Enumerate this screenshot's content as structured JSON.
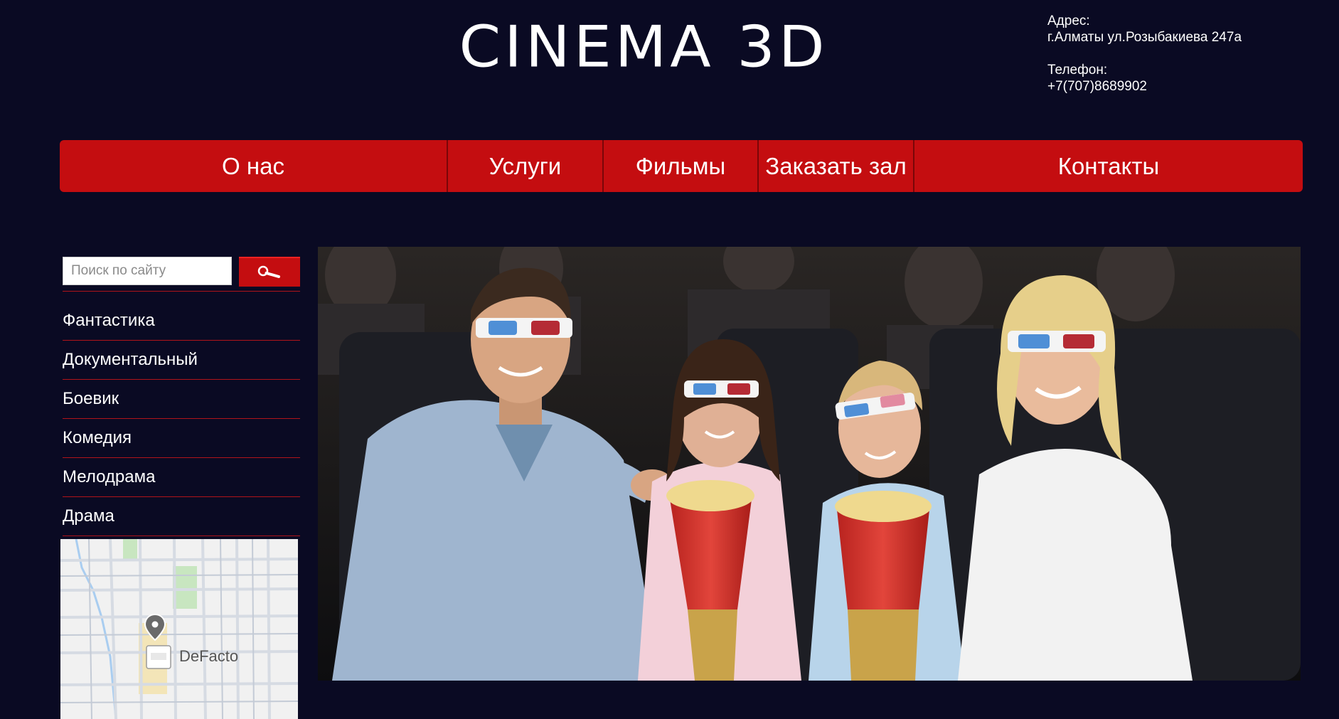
{
  "header": {
    "logo": "CINEMA 3D",
    "address_label": "Адрес:",
    "address_value": "г.Алматы ул.Розыбакиева 247а",
    "phone_label": "Телефон:",
    "phone_value": "+7(707)8689902"
  },
  "nav": {
    "items": [
      {
        "label": "О нас"
      },
      {
        "label": "Услуги"
      },
      {
        "label": "Фильмы"
      },
      {
        "label": "Заказать зал"
      },
      {
        "label": "Контакты"
      }
    ]
  },
  "search": {
    "placeholder": "Поиск по сайту",
    "icon": "magnifier-icon"
  },
  "categories": {
    "items": [
      {
        "label": "Фантастика"
      },
      {
        "label": "Документальный"
      },
      {
        "label": "Боевик"
      },
      {
        "label": "Комедия"
      },
      {
        "label": "Мелодрама"
      },
      {
        "label": "Драма"
      }
    ]
  },
  "map": {
    "place_label": "DeFacto",
    "icon": "map-pin-icon"
  },
  "hero": {
    "description_icon": "family-3d-glasses-photo"
  },
  "colors": {
    "background": "#0a0a23",
    "accent": "#c40d10",
    "divider": "#b0141a"
  }
}
